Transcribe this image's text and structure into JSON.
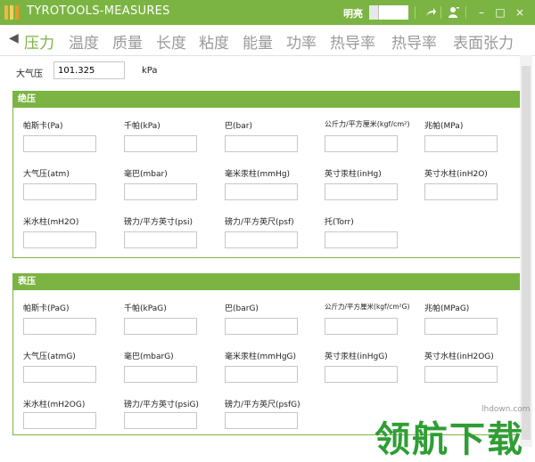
{
  "window": {
    "title": "TYROTOOLS-MEASURES",
    "theme_label": "明亮",
    "buttons": {
      "share": "share-icon",
      "user": "user-icon",
      "minimize": "–",
      "maximize": "□",
      "close": "×"
    }
  },
  "tabs": {
    "prev_arrow": "◀",
    "items": [
      {
        "label": "压力",
        "active": true
      },
      {
        "label": "温度"
      },
      {
        "label": "质量"
      },
      {
        "label": "长度"
      },
      {
        "label": "粘度"
      },
      {
        "label": "能量"
      },
      {
        "label": "功率"
      },
      {
        "label": "热导率"
      },
      {
        "label": "热导率"
      },
      {
        "label": "表面张力"
      }
    ]
  },
  "atmosphere": {
    "label": "大气压",
    "value": "101.325",
    "unit": "kPa"
  },
  "absolute": {
    "title": "绝压",
    "fields": [
      "帕斯卡(Pa)",
      "千帕(kPa)",
      "巴(bar)",
      "公斤力/平方厘米(kgf/cm²)",
      "兆帕(MPa)",
      "大气压(atm)",
      "毫巴(mbar)",
      "毫米汞柱(mmHg)",
      "英寸汞柱(inHg)",
      "英寸水柱(inH2O)",
      "米水柱(mH2O)",
      "磅力/平方英寸(psi)",
      "磅力/平方英尺(psf)",
      "托(Torr)"
    ]
  },
  "gauge": {
    "title": "表压",
    "fields": [
      "帕斯卡(PaG)",
      "千帕(kPaG)",
      "巴(barG)",
      "公斤力/平方厘米(kgf/cm²G)",
      "兆帕(MPaG)",
      "大气压(atmG)",
      "毫巴(mbarG)",
      "毫米汞柱(mmHgG)",
      "英寸汞柱(inHgG)",
      "英寸水柱(inH2OG)",
      "米水柱(mH2OG)",
      "磅力/平方英寸(psiG)",
      "磅力/平方英尺(psfG)"
    ]
  },
  "watermark": {
    "text": "领航下载",
    "url": "lhdown.com"
  },
  "colors": {
    "accent": "#7bb443",
    "tab_inactive": "#9a9a9a",
    "watermark": "#2f9e35"
  }
}
